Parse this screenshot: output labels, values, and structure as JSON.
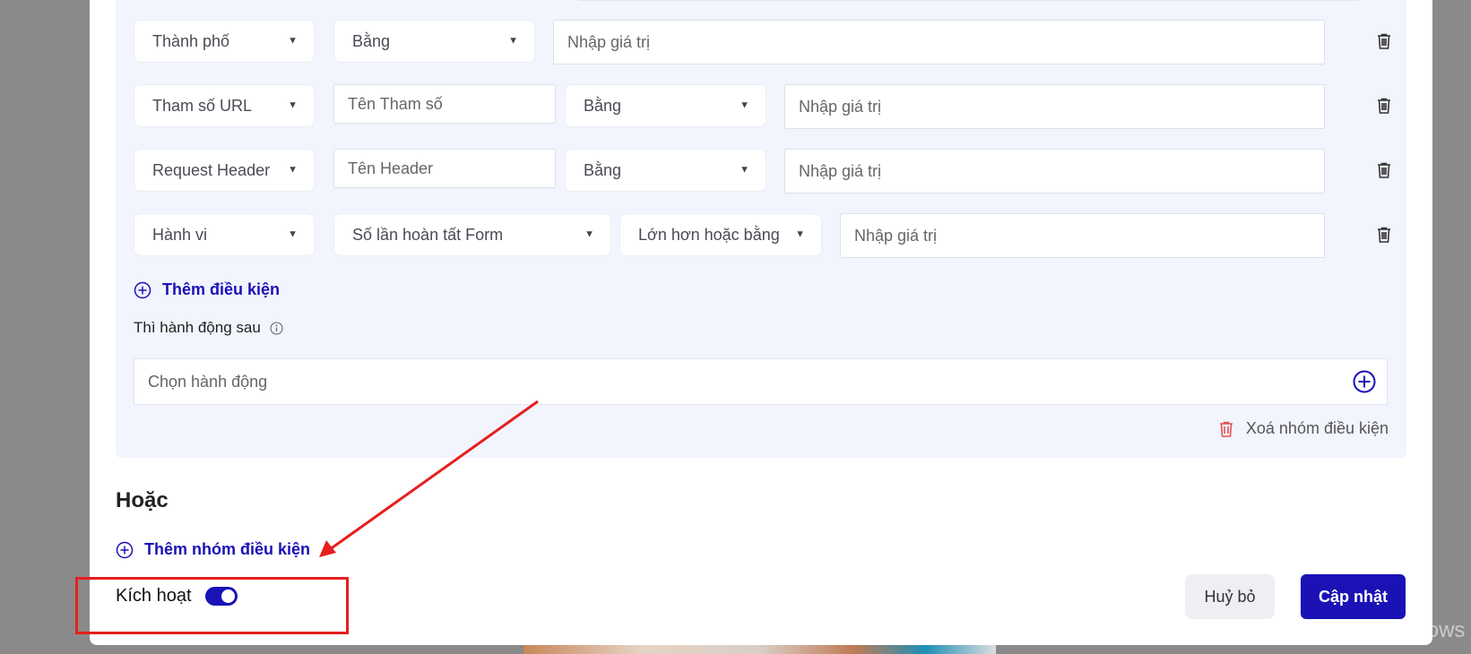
{
  "conditions": [
    {
      "field": "Thành phố",
      "operator": "Bằng",
      "value_placeholder": "Nhập giá trị"
    },
    {
      "field": "Tham số URL",
      "param_placeholder": "Tên Tham số",
      "operator": "Bằng",
      "value_placeholder": "Nhập giá trị"
    },
    {
      "field": "Request Header",
      "param_placeholder": "Tên Header",
      "operator": "Bằng",
      "value_placeholder": "Nhập giá trị"
    },
    {
      "field": "Hành vi",
      "metric": "Số lần hoàn tất Form",
      "operator": "Lớn hơn hoặc bằng",
      "value_placeholder": "Nhập giá trị"
    }
  ],
  "add_condition_label": "Thêm điều kiện",
  "then_action_label": "Thì hành động sau",
  "action_placeholder": "Chọn hành động",
  "delete_group_label": "Xoá nhóm điều kiện",
  "or_heading": "Hoặc",
  "add_group_label": "Thêm nhóm điều kiện",
  "activate_label": "Kích hoạt",
  "activate_enabled": true,
  "cancel_label": "Huỷ bỏ",
  "update_label": "Cập nhật",
  "watermark": "Activate Windows",
  "colors": {
    "primary": "#1a12b5",
    "annotation_red": "#e61e1e",
    "danger": "#e05252",
    "group_bg": "#f2f4fe"
  }
}
